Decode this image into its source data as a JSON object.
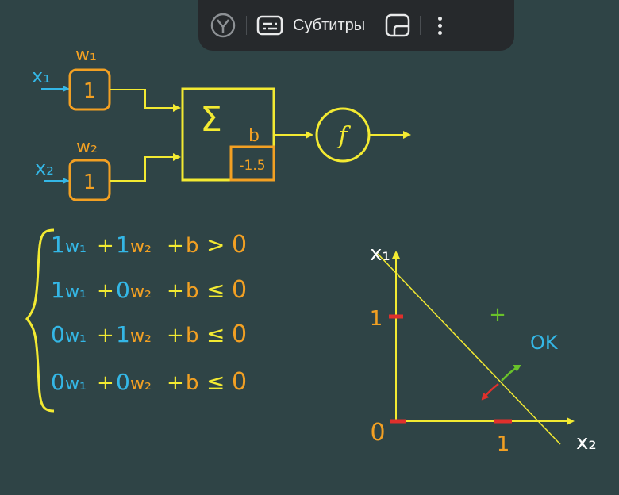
{
  "toolbar": {
    "browser_icon": "yandex-browser-icon",
    "subtitles_icon": "subtitles-icon",
    "subtitles_label": "Субтитры",
    "pip_icon": "picture-in-picture-icon",
    "menu_icon": "more-vertical-icon"
  },
  "perceptron": {
    "input1": "x₁",
    "input2": "x₂",
    "weight1_label": "w₁",
    "weight2_label": "w₂",
    "weight1_value": "1",
    "weight2_value": "1",
    "sum_symbol": "Σ",
    "bias_label": "b",
    "bias_value": "-1.5",
    "activation": "f"
  },
  "inequalities": [
    {
      "c1": "1",
      "c2": "1",
      "rel": ">",
      "rhs": "0"
    },
    {
      "c1": "1",
      "c2": "0",
      "rel": "≤",
      "rhs": "0"
    },
    {
      "c1": "0",
      "c2": "1",
      "rel": "≤",
      "rhs": "0"
    },
    {
      "c1": "0",
      "c2": "0",
      "rel": "≤",
      "rhs": "0"
    }
  ],
  "terms": {
    "w1": "w₁",
    "w2": "w₂",
    "plus": "+",
    "b": "b"
  },
  "plot": {
    "y_axis_label": "x₁",
    "x_axis_label": "x₂",
    "origin": "0",
    "y_tick": "1",
    "x_tick": "1",
    "positive_marker": "+",
    "ok_label": "OK"
  },
  "colors": {
    "background": "#2f4446",
    "yellow": "#f3ea32",
    "orange": "#f2a023",
    "cyan": "#34b7e6",
    "red": "#e0302c",
    "green": "#69c22a",
    "white": "#ffffff"
  }
}
